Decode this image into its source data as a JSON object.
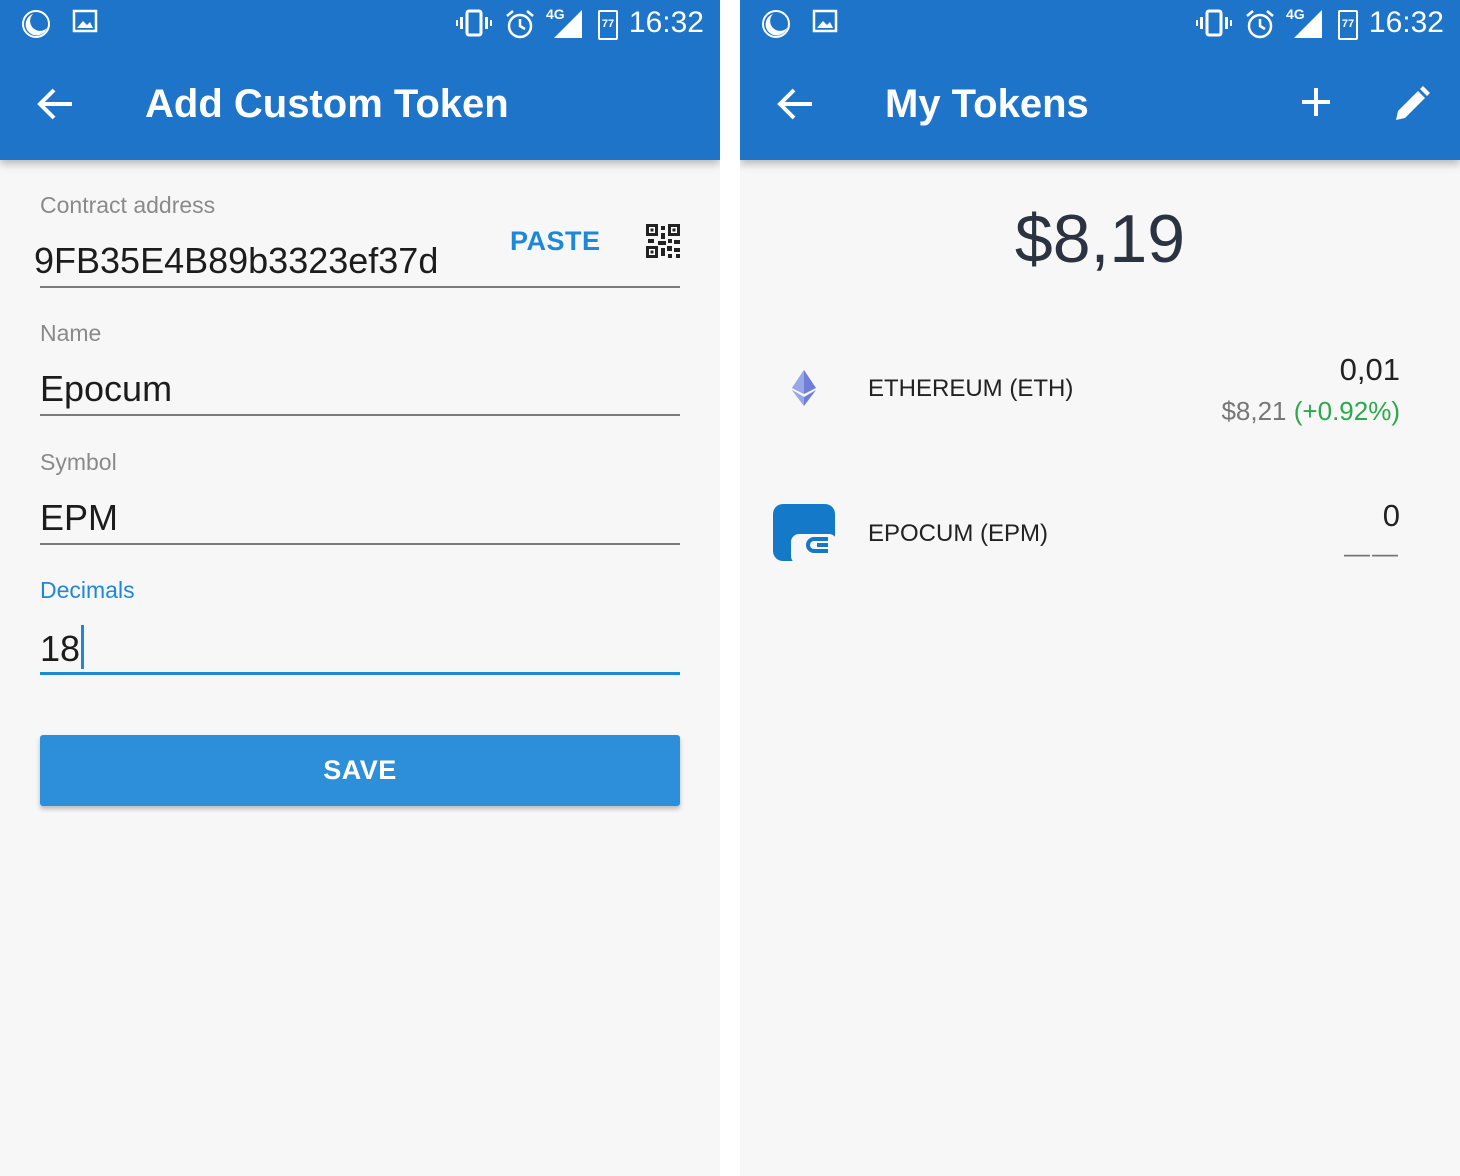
{
  "status_bar": {
    "time": "16:32",
    "network": "4G",
    "calendar_day": "77"
  },
  "left_screen": {
    "title": "Add Custom Token",
    "fields": {
      "contract_address": {
        "label": "Contract address",
        "value": "9FB35E4B89b3323ef37d"
      },
      "name": {
        "label": "Name",
        "value": "Epocum"
      },
      "symbol": {
        "label": "Symbol",
        "value": "EPM"
      },
      "decimals": {
        "label": "Decimals",
        "value": "18"
      }
    },
    "paste_label": "PASTE",
    "save_label": "SAVE"
  },
  "right_screen": {
    "title": "My Tokens",
    "balance": "$8,19",
    "tokens": [
      {
        "name": "ETHEREUM (ETH)",
        "amount": "0,01",
        "fiat": "$8,21",
        "change": "(+0.92%)",
        "icon": "ethereum-icon"
      },
      {
        "name": "EPOCUM (EPM)",
        "amount": "0",
        "fiat": "——",
        "icon": "epocum-icon"
      }
    ]
  },
  "colors": {
    "app_bar": "#1e74c9",
    "accent": "#1e88d8",
    "positive": "#2ca94a"
  }
}
